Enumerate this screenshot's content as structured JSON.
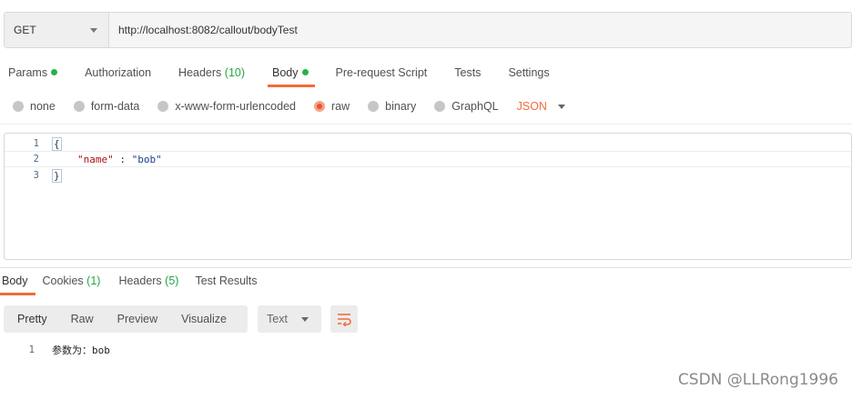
{
  "request": {
    "method": "GET",
    "url": "http://localhost:8082/callout/bodyTest"
  },
  "request_tabs": [
    {
      "label": "Params",
      "dot": true
    },
    {
      "label": "Authorization"
    },
    {
      "label": "Headers",
      "count": "(10)"
    },
    {
      "label": "Body",
      "dot": true,
      "active": true
    },
    {
      "label": "Pre-request Script"
    },
    {
      "label": "Tests"
    },
    {
      "label": "Settings"
    }
  ],
  "body_types": [
    {
      "label": "none",
      "selected": false
    },
    {
      "label": "form-data",
      "selected": false
    },
    {
      "label": "x-www-form-urlencoded",
      "selected": false
    },
    {
      "label": "raw",
      "selected": true
    },
    {
      "label": "binary",
      "selected": false
    },
    {
      "label": "GraphQL",
      "selected": false
    }
  ],
  "raw_language": "JSON",
  "editor": {
    "lines": [
      {
        "num": "1",
        "text": "{"
      },
      {
        "num": "2",
        "key": "\"name\"",
        "sep": " : ",
        "value": "\"bob\""
      },
      {
        "num": "3",
        "text": "}"
      }
    ]
  },
  "response_tabs": [
    {
      "label": "Body",
      "active": true
    },
    {
      "label": "Cookies",
      "count": "(1)"
    },
    {
      "label": "Headers",
      "count": "(5)"
    },
    {
      "label": "Test Results"
    }
  ],
  "view_modes": [
    "Pretty",
    "Raw",
    "Preview",
    "Visualize"
  ],
  "format_select": "Text",
  "response_body": [
    {
      "num": "1",
      "text": "参数为：bob"
    }
  ],
  "watermark": "CSDN @LLRong1996",
  "colors": {
    "accent": "#f26b3a",
    "dot_green": "#26b14c",
    "count_green": "#26a346"
  },
  "icons": {
    "wrap": "wrap-lines-icon",
    "method_caret": "chevron-down-icon"
  }
}
